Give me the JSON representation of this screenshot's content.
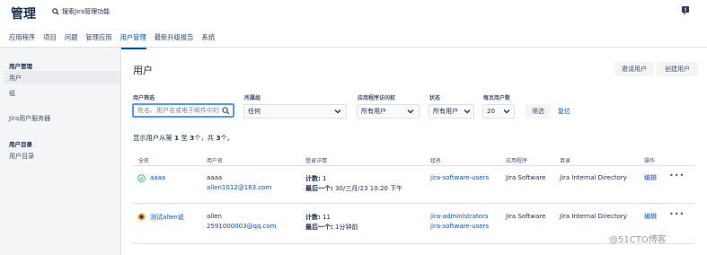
{
  "header": {
    "title": "管理",
    "search_label": "搜索Jira管理功能",
    "feedback_icon": "feedback-flag-icon"
  },
  "tabs": [
    {
      "label": "应用程序"
    },
    {
      "label": "项目"
    },
    {
      "label": "问题"
    },
    {
      "label": "管理应用"
    },
    {
      "label": "用户管理",
      "active": true
    },
    {
      "label": "最新升级报告"
    },
    {
      "label": "系统"
    }
  ],
  "sidebar": {
    "section1_title": "用户管理",
    "item_users": "用户",
    "item_groups": "组",
    "item_jira_server": "Jira用户服务器",
    "section2_title": "用户目录",
    "item_directory": "用户目录"
  },
  "main": {
    "title": "用户",
    "invite_button": "邀请用户",
    "create_button": "创建用户"
  },
  "filters": {
    "user_filter_label": "用户筛选",
    "user_filter_placeholder": "姓名、用户名或电子邮件中的",
    "group_label": "所属组",
    "group_value": "任何",
    "access_label": "应用程序访问权",
    "access_value": "所有用户",
    "status_label": "状态",
    "status_value": "所有用户",
    "per_page_label": "每页用户数",
    "per_page_value": "20",
    "filter_button": "筛选",
    "reset_link": "复位"
  },
  "summary": {
    "prefix": "显示用户从第",
    "from": "1",
    "to_word": "至",
    "to": "3",
    "total_word": "个，共",
    "total": "3",
    "suffix": "个。"
  },
  "table": {
    "headers": [
      "全名",
      "用户名",
      "登录详情",
      "组名",
      "应用程序",
      "目录",
      "操作"
    ],
    "rows": [
      {
        "fullname": "aaaa",
        "username": "aaaa",
        "email": "allen1012@163.com",
        "count_label": "计数:",
        "count": "1",
        "last_label": "最后一个:",
        "last": "30/三月/23 10:20 下午",
        "groups": [
          "jira-software-users"
        ],
        "application": "Jira Software",
        "directory": "Jira Internal Directory",
        "edit": "编辑",
        "more": "•••"
      },
      {
        "fullname": "测试allen说",
        "username": "allen",
        "email": "2591000003@qq.com",
        "count_label": "计数:",
        "count": "11",
        "last_label": "最后一个:",
        "last": "1分钟前",
        "groups": [
          "jira-administrators",
          "jira-software-users"
        ],
        "application": "Jira Software",
        "directory": "Jira Internal Directory",
        "edit": "编辑",
        "more": "•••"
      }
    ]
  },
  "watermark": "@51CTO博客",
  "colors": {
    "accent": "#0052cc",
    "focus_border": "#4c9aff",
    "sidebar_bg": "#f4f5f7",
    "text": "#172b4d"
  }
}
